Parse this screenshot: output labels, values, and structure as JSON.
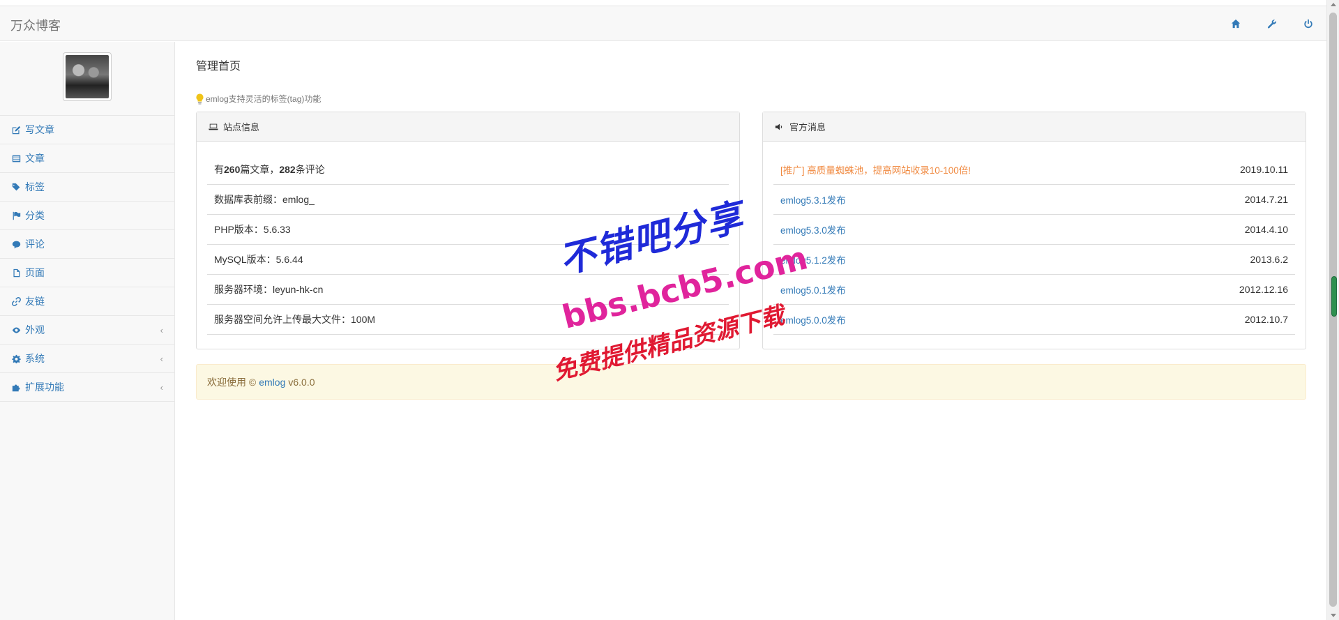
{
  "navbar": {
    "brand": "万众博客",
    "icons": [
      "home-icon",
      "wrench-icon",
      "power-icon"
    ]
  },
  "sidebar": {
    "items": [
      {
        "label": "写文章",
        "icon": "edit-icon"
      },
      {
        "label": "文章",
        "icon": "list-icon"
      },
      {
        "label": "标签",
        "icon": "tags-icon"
      },
      {
        "label": "分类",
        "icon": "flag-icon"
      },
      {
        "label": "评论",
        "icon": "comments-icon"
      },
      {
        "label": "页面",
        "icon": "file-icon"
      },
      {
        "label": "友链",
        "icon": "link-icon"
      },
      {
        "label": "外观",
        "icon": "eye-icon",
        "chevron": "‹"
      },
      {
        "label": "系统",
        "icon": "cog-icon",
        "chevron": "‹"
      },
      {
        "label": "扩展功能",
        "icon": "puzzle-icon",
        "chevron": "‹"
      }
    ]
  },
  "main": {
    "title": "管理首页",
    "tip": "emlog支持灵活的标签(tag)功能",
    "site_panel": {
      "title": "站点信息",
      "stats": {
        "pre": "有",
        "articles": "260",
        "mid": "篇文章，",
        "comments": "282",
        "post": "条评论"
      },
      "rows": [
        "数据库表前缀：emlog_",
        "PHP版本：5.6.33",
        "MySQL版本：5.6.44",
        "服务器环境：leyun-hk-cn",
        "服务器空间允许上传最大文件：100M"
      ]
    },
    "news_panel": {
      "title": "官方消息",
      "items": [
        {
          "title": "[推广] 高质量蜘蛛池，提高网站收录10-100倍!",
          "date": "2019.10.11"
        },
        {
          "title": "emlog5.3.1发布",
          "date": "2014.7.21"
        },
        {
          "title": "emlog5.3.0发布",
          "date": "2014.4.10"
        },
        {
          "title": "emlog5.1.2发布",
          "date": "2013.6.2"
        },
        {
          "title": "emlog5.0.1发布",
          "date": "2012.12.16"
        },
        {
          "title": "emlog5.0.0发布",
          "date": "2012.10.7"
        }
      ]
    },
    "welcome": {
      "pre": "欢迎使用 ©",
      "link": "emlog",
      "version": "v6.0.0"
    }
  },
  "watermark": {
    "line1": "不错吧分享",
    "line2": "bbs.bcb5.com",
    "line3": "免费提供精品资源下载"
  },
  "colors": {
    "link": "#337ab7",
    "promo": "#f0883e",
    "welcome_bg": "#fcf8e3"
  }
}
